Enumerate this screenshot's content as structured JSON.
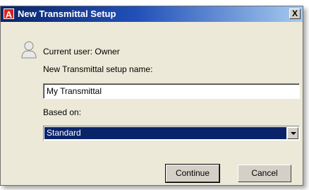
{
  "window": {
    "title": "New Transmittal Setup",
    "app_icon_letter": "A",
    "close_label": "X"
  },
  "user": {
    "icon": "user-icon",
    "current_user_text": "Current user: Owner"
  },
  "setup_name": {
    "label": "New Transmittal setup name:",
    "value": "My Transmittal"
  },
  "based_on": {
    "label": "Based on:",
    "selected": "Standard"
  },
  "buttons": {
    "continue_label": "Continue",
    "cancel_label": "Cancel"
  },
  "colors": {
    "title_bar": "#0a246a",
    "dialog_bg": "#ece9d8",
    "selection_bg": "#0a246a",
    "app_icon_bg": "#d9221a"
  }
}
